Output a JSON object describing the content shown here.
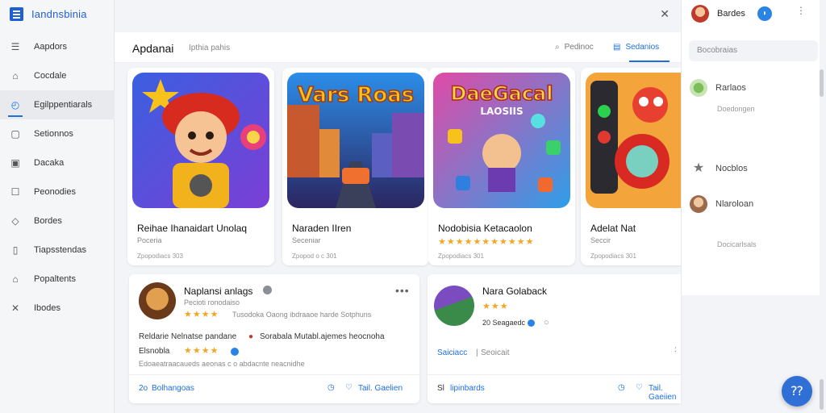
{
  "app": {
    "title": "Iandnsbinia"
  },
  "sidebar": {
    "items": [
      {
        "label": "Aapdors",
        "icon": "menu-icon"
      },
      {
        "label": "Cocdale",
        "icon": "home-icon"
      },
      {
        "label": "Egilppentiarals",
        "icon": "compass-icon",
        "active": true
      },
      {
        "label": "Setionnos",
        "icon": "square-icon"
      },
      {
        "label": "Dacaka",
        "icon": "image-icon"
      },
      {
        "label": "Peonodies",
        "icon": "box-icon"
      },
      {
        "label": "Bordes",
        "icon": "tag-icon"
      },
      {
        "label": "Tiapsstendas",
        "icon": "file-icon"
      },
      {
        "label": "Popaltents",
        "icon": "house-icon"
      },
      {
        "label": "Ibodes",
        "icon": "tools-icon"
      }
    ]
  },
  "header": {
    "title": "Apdanai",
    "subtitle": "Ipthia pahis",
    "search_label": "Pedinoc",
    "tab_label": "Sedanios"
  },
  "cards": [
    {
      "name": "Reihae Ihanaidart Unolaq",
      "category": "Poceria",
      "meta": "Zpopodiacs 303"
    },
    {
      "name": "Naraden IIren",
      "category": "Seceniar",
      "meta": "Zpopod o c 301"
    },
    {
      "name": "Nodobisia Ketacaolon",
      "category": "",
      "meta": "Zpopodiacs 301",
      "stars": "★★★★★★★★★★★"
    },
    {
      "name": "Adelat Nat",
      "category": "Seccir",
      "meta": "Zpopodiacs 301"
    }
  ],
  "art": {
    "card1": "",
    "card2": "Vars Roas",
    "card3": "DaeGacal",
    "card3b": "LAOSIIS"
  },
  "review1": {
    "name": "Naplansi anlags",
    "sub": "Pecioti ronodaiso",
    "stars": "★★★★",
    "rating_text": "Tusodoka Oaong ibdraaoe harde Sotphuns",
    "body1": "Reldarie Nelnatse pandane",
    "body1b": "Sorabala Mutabl.ajemes heocnoha",
    "body2": "Elsnobla",
    "body2_stars": "★★★★",
    "body3": "Edoaeatraacaueds aeonas c o abdacnte neacnidhe",
    "footer_link": "Bolhangoas",
    "footer_prefix": "2o",
    "action_label": "Tail. Gaelien",
    "more": "•••"
  },
  "review2": {
    "name": "Nara Golaback",
    "stars": "★★★",
    "meta": "20 Seagaedc",
    "link1": "Saiciacc",
    "link2": "Seoicait",
    "footer_link": "lipinbards",
    "footer_prefix": "Sl",
    "action_label": "Tail. Gaeiien"
  },
  "right_panel": {
    "user_name": "Bardes",
    "search_placeholder": "Bocobraias",
    "items": [
      {
        "label": "Rarlaos",
        "sub": "Doedongen"
      },
      {
        "label": "Nocblos",
        "sub": ""
      },
      {
        "label": "Nlaroloan",
        "sub": "Docicarlsals"
      }
    ]
  },
  "colors": {
    "accent": "#1f6fe0",
    "star": "#f2a623"
  }
}
